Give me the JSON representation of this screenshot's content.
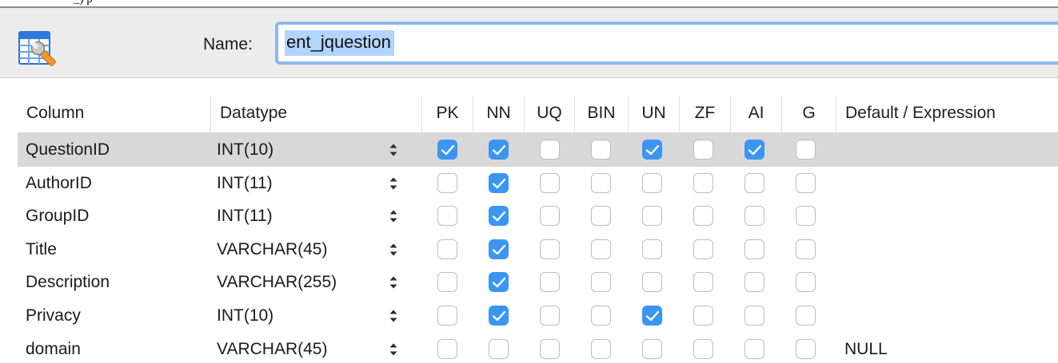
{
  "top_strip": {
    "fragment_text": "_) p"
  },
  "header": {
    "icon": "table-wrench-icon",
    "name_label": "Name:",
    "name_value": "ent_jquestion"
  },
  "columns_table": {
    "headers": {
      "column": "Column",
      "datatype": "Datatype",
      "pk": "PK",
      "nn": "NN",
      "uq": "UQ",
      "bin": "BIN",
      "un": "UN",
      "zf": "ZF",
      "ai": "AI",
      "g": "G",
      "default": "Default / Expression"
    },
    "rows": [
      {
        "name": "QuestionID",
        "datatype": "INT(10)",
        "default": "",
        "selected": true,
        "flags": {
          "pk": true,
          "nn": true,
          "uq": false,
          "bin": false,
          "un": true,
          "zf": false,
          "ai": true,
          "g": false
        }
      },
      {
        "name": "AuthorID",
        "datatype": "INT(11)",
        "default": "",
        "selected": false,
        "flags": {
          "pk": false,
          "nn": true,
          "uq": false,
          "bin": false,
          "un": false,
          "zf": false,
          "ai": false,
          "g": false
        }
      },
      {
        "name": "GroupID",
        "datatype": "INT(11)",
        "default": "",
        "selected": false,
        "flags": {
          "pk": false,
          "nn": true,
          "uq": false,
          "bin": false,
          "un": false,
          "zf": false,
          "ai": false,
          "g": false
        }
      },
      {
        "name": "Title",
        "datatype": "VARCHAR(45)",
        "default": "",
        "selected": false,
        "flags": {
          "pk": false,
          "nn": true,
          "uq": false,
          "bin": false,
          "un": false,
          "zf": false,
          "ai": false,
          "g": false
        }
      },
      {
        "name": "Description",
        "datatype": "VARCHAR(255)",
        "default": "",
        "selected": false,
        "flags": {
          "pk": false,
          "nn": true,
          "uq": false,
          "bin": false,
          "un": false,
          "zf": false,
          "ai": false,
          "g": false
        }
      },
      {
        "name": "Privacy",
        "datatype": "INT(10)",
        "default": "",
        "selected": false,
        "flags": {
          "pk": false,
          "nn": true,
          "uq": false,
          "bin": false,
          "un": true,
          "zf": false,
          "ai": false,
          "g": false
        }
      },
      {
        "name": "domain",
        "datatype": "VARCHAR(45)",
        "default": "NULL",
        "selected": false,
        "flags": {
          "pk": false,
          "nn": false,
          "uq": false,
          "bin": false,
          "un": false,
          "zf": false,
          "ai": false,
          "g": false
        }
      }
    ]
  },
  "colors": {
    "accent": "#3b95f2",
    "selection_row": "#d8d8d8",
    "input_focus_ring": "#8db8ec",
    "text_selection": "#b3d4fc",
    "header_bg": "#ececec"
  }
}
